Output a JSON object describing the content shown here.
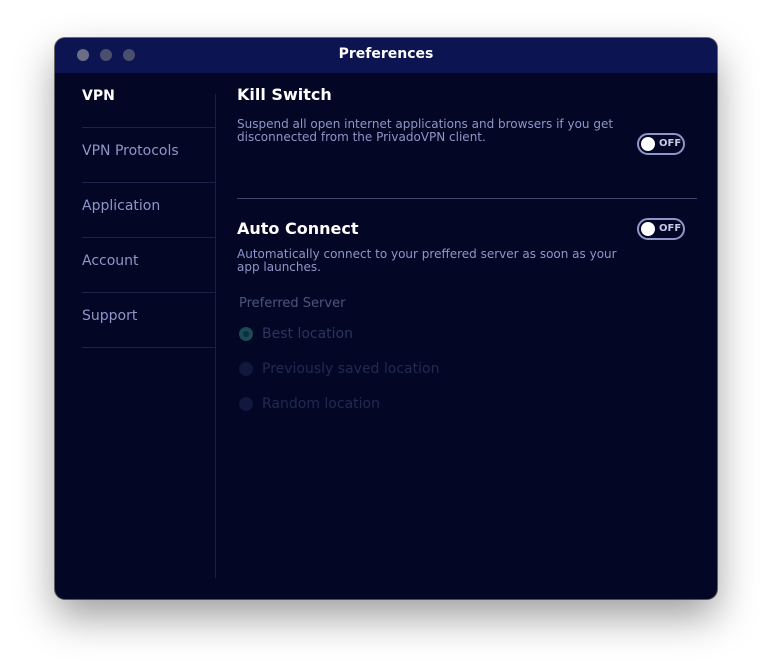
{
  "window": {
    "title": "Preferences"
  },
  "sidebar": {
    "items": [
      {
        "label": "VPN",
        "active": true
      },
      {
        "label": "VPN Protocols",
        "active": false
      },
      {
        "label": "Application",
        "active": false
      },
      {
        "label": "Account",
        "active": false
      },
      {
        "label": "Support",
        "active": false
      }
    ]
  },
  "kill_switch": {
    "title": "Kill Switch",
    "description": "Suspend all open internet applications and browsers if you get disconnected from the PrivadoVPN client.",
    "toggle_label": "OFF",
    "enabled": false
  },
  "auto_connect": {
    "title": "Auto Connect",
    "description": "Automatically connect to your preffered server as soon as your app launches.",
    "toggle_label": "OFF",
    "enabled": false
  },
  "preferred_server": {
    "label": "Preferred Server",
    "options": [
      {
        "label": "Best location",
        "selected": true
      },
      {
        "label": "Previously saved location",
        "selected": false
      },
      {
        "label": "Random location",
        "selected": false
      }
    ]
  },
  "colors": {
    "background": "#030624",
    "titlebar": "#0c1552",
    "accent_text": "#8f96c8"
  }
}
